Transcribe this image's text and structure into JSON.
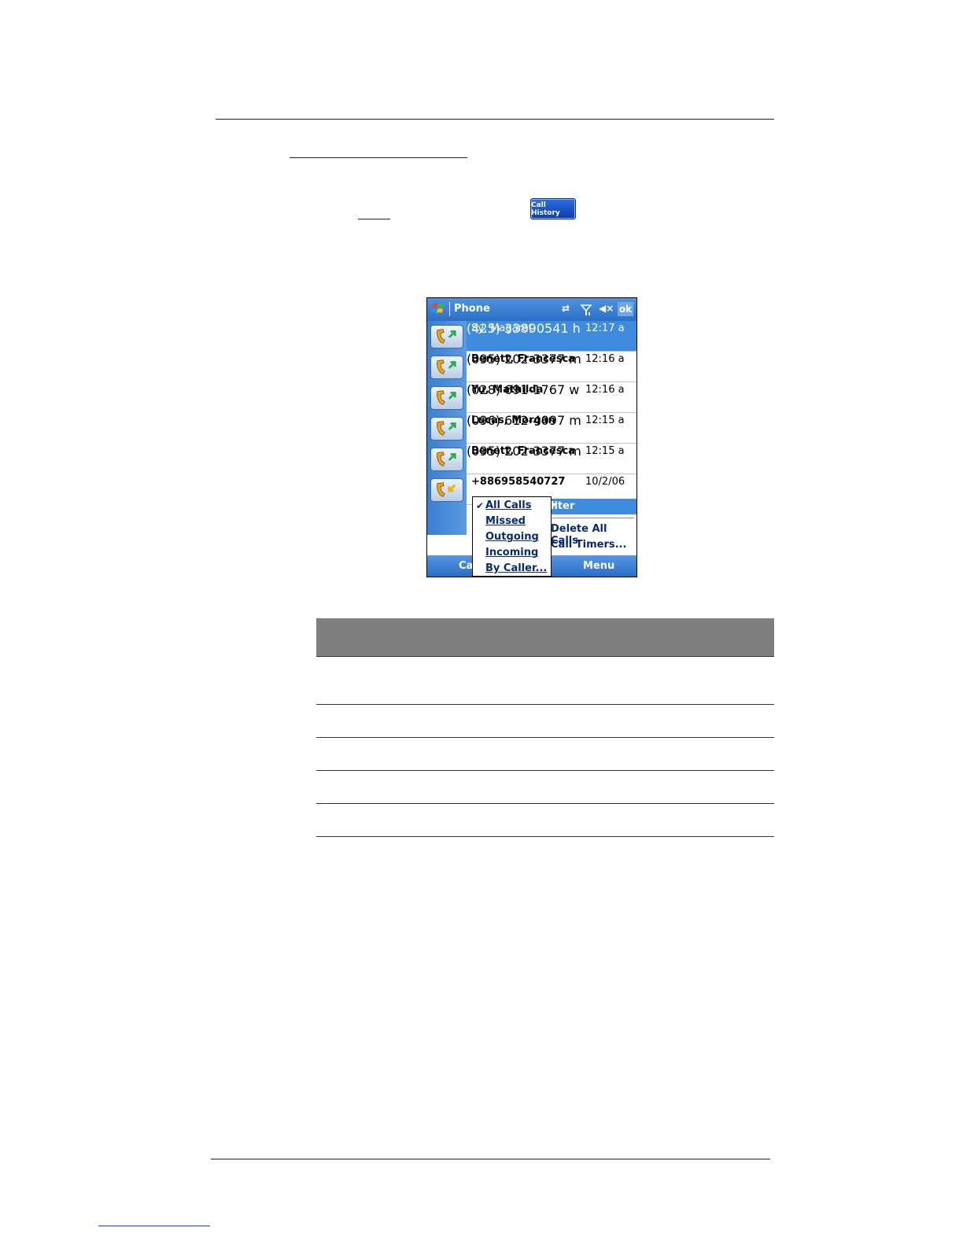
{
  "call_history_button": {
    "label": "Call History"
  },
  "phone": {
    "title": "Phone",
    "ok_label": "ok",
    "calls": [
      {
        "name": "Sy, Magaret",
        "number": "(425) 33890541 h",
        "time": "12:17 a",
        "direction": "outgoing",
        "selected": true
      },
      {
        "name": "Benett, Francesca",
        "number": "(095) 202-3377 m",
        "time": "12:16 a",
        "direction": "outgoing"
      },
      {
        "name": "Yu, Mathilda",
        "number": "(028) 691-1767 w",
        "time": "12:16 a",
        "direction": "outgoing"
      },
      {
        "name": "Lucas, Morgan",
        "number": "(096) 612-4097 m",
        "time": "12:15 a",
        "direction": "outgoing"
      },
      {
        "name": "Benett, Francesca",
        "number": "(095) 202-3377 m",
        "time": "12:15 a",
        "direction": "outgoing"
      },
      {
        "name": "+886958540727",
        "number": "",
        "time": "10/2/06",
        "direction": "incoming"
      }
    ],
    "main_menu": {
      "filter": "ilter",
      "delete_all": "Delete All Calls",
      "call_timers": "Call Timers..."
    },
    "filter_submenu": [
      {
        "label": "All Calls",
        "checked": true
      },
      {
        "label": "Missed"
      },
      {
        "label": "Outgoing"
      },
      {
        "label": "Incoming"
      },
      {
        "label": "By Caller..."
      }
    ],
    "softkeys": {
      "left": "Cal",
      "right": "Menu"
    }
  },
  "colors": {
    "accent": "#3f8be0",
    "table_header": "#7f7f7f"
  }
}
